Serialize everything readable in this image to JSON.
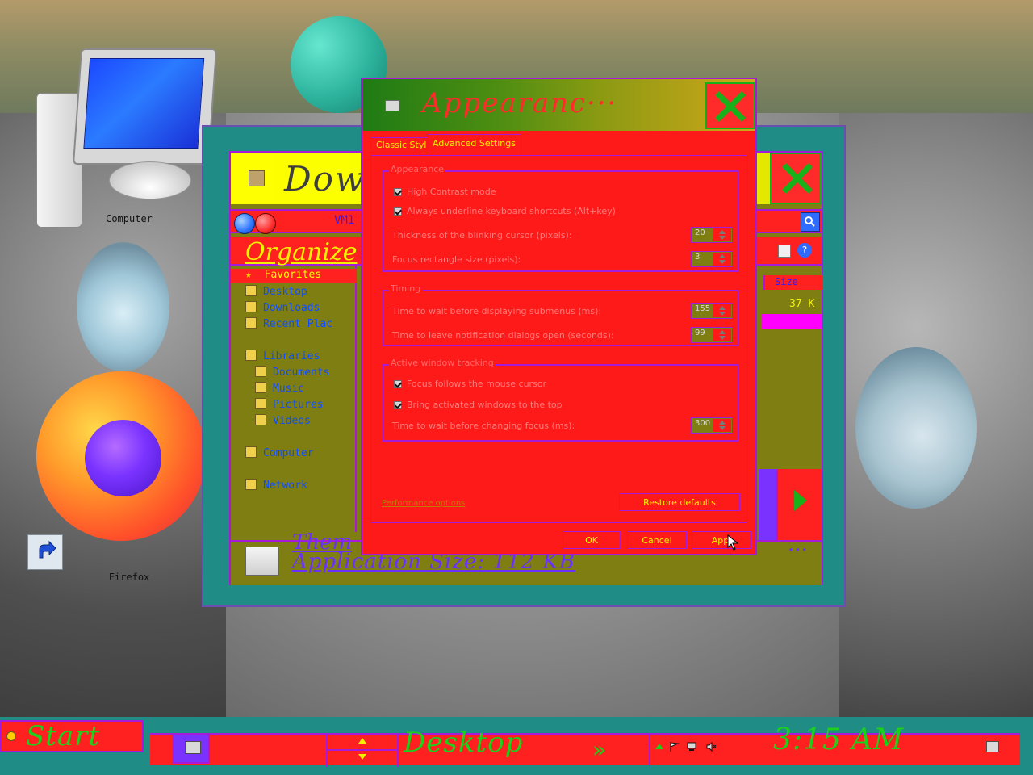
{
  "desktop": {
    "icons": [
      {
        "label": "Computer"
      },
      {
        "label": "Firefox"
      }
    ]
  },
  "explorer": {
    "title": "Dow",
    "nav": {
      "location_label": "VM1"
    },
    "commands": {
      "organize_label": "Organize"
    },
    "nav_pane": {
      "favorites_label": "Favorites",
      "items": [
        "Desktop",
        "Downloads",
        "Recent Plac"
      ],
      "libraries_label": "Libraries",
      "library_items": [
        "Documents",
        "Music",
        "Pictures",
        "Videos"
      ],
      "computer_label": "Computer",
      "network_label": "Network"
    },
    "columns": {
      "size_header": "Size"
    },
    "file_size_value": "37 K",
    "details": {
      "line1": "Them",
      "line2": "Application  Size: 112 KB",
      "ellipsis": "..."
    }
  },
  "dialog": {
    "title": "Appearanc···",
    "tabs": [
      {
        "label": "Classic Style"
      },
      {
        "label": "Advanced Settings"
      }
    ],
    "groups": {
      "appearance": {
        "title": "Appearance",
        "checkbox_1": "High Contrast mode",
        "checkbox_2": "Always underline keyboard shortcuts (Alt+key)",
        "thickness_label": "Thickness of the blinking cursor (pixels):",
        "thickness_value": "20",
        "focus_rect_label": "Focus rectangle size (pixels):",
        "focus_rect_value": "3"
      },
      "timing": {
        "title": "Timing",
        "submenu_label": "Time to wait before displaying submenus (ms):",
        "submenu_value": "155",
        "notification_label": "Time to leave notification dialogs open (seconds):",
        "notification_value": "99"
      },
      "tracking": {
        "title": "Active window tracking",
        "checkbox_1": "Focus follows the mouse cursor",
        "checkbox_2": "Bring activated windows to the top",
        "focus_wait_label": "Time to wait before changing focus (ms):",
        "focus_wait_value": "300"
      }
    },
    "performance_link": "Performance options",
    "buttons": {
      "restore_defaults": "Restore defaults",
      "ok": "OK",
      "cancel": "Cancel",
      "apply": "Appl"
    }
  },
  "taskbar": {
    "start_label": "Start",
    "desktop_label": "Desktop",
    "chevrons": "»",
    "clock": "3:15 AM"
  }
}
